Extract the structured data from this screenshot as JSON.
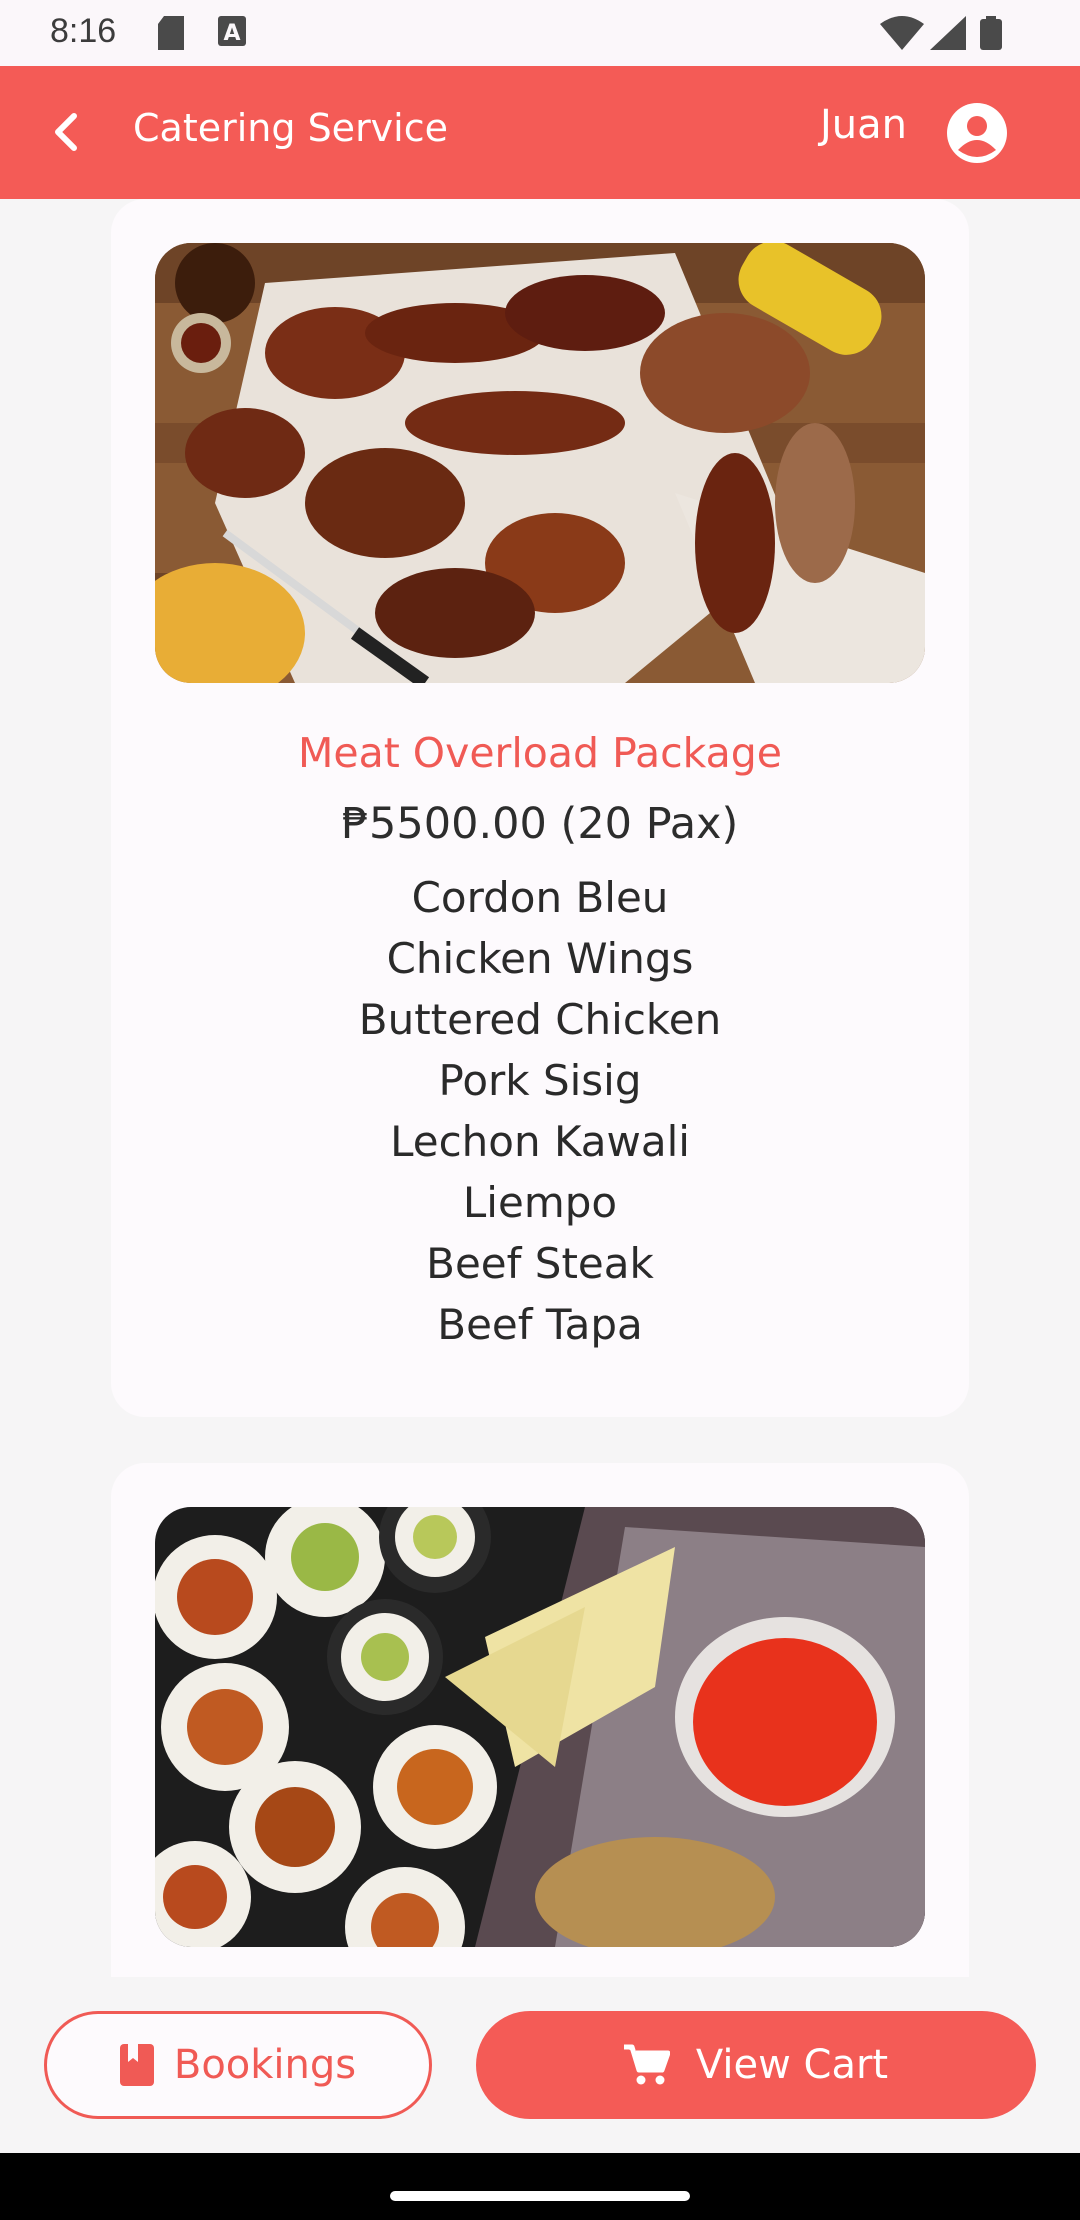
{
  "status_bar": {
    "time": "8:16"
  },
  "app_bar": {
    "title": "Catering Service",
    "user_name": "Juan"
  },
  "packages": [
    {
      "name": "Meat Overload Package",
      "price": "₱5500.00 (20 Pax)",
      "items": [
        "Cordon Bleu",
        "Chicken Wings",
        "Buttered Chicken",
        "Pork Sisig",
        "Lechon Kawali",
        "Liempo",
        "Beef Steak",
        "Beef Tapa"
      ]
    }
  ],
  "bottom_actions": {
    "bookings_label": "Bookings",
    "cart_label": "View Cart"
  },
  "colors": {
    "accent": "#f45b56",
    "background": "#f6f5f6",
    "card": "#fdfafd"
  },
  "icons": [
    "back-arrow-icon",
    "account-circle-icon",
    "bookmark-icon",
    "shopping-cart-icon",
    "sd-card-icon",
    "text-a-icon",
    "wifi-icon",
    "signal-icon",
    "battery-icon"
  ]
}
